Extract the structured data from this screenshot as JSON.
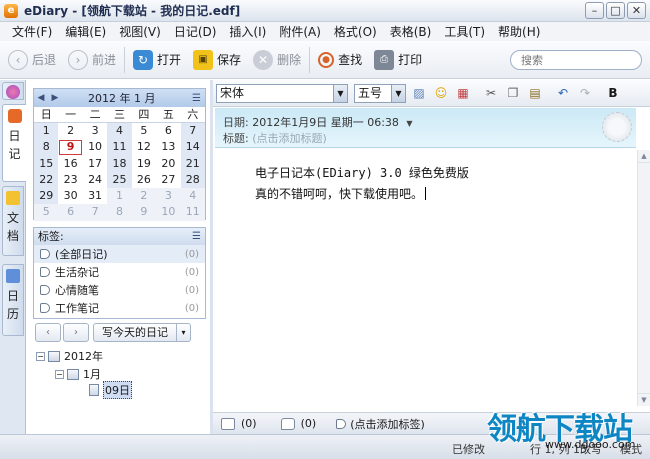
{
  "window": {
    "title": "eDiary - [领航下载站 - 我的日记.edf]",
    "controls": [
      "–",
      "□",
      "✕"
    ]
  },
  "menu": [
    "文件(F)",
    "编辑(E)",
    "视图(V)",
    "日记(D)",
    "插入(I)",
    "附件(A)",
    "格式(O)",
    "表格(B)",
    "工具(T)",
    "帮助(H)"
  ],
  "toolbar": {
    "back": "后退",
    "forward": "前进",
    "open": "打开",
    "save": "保存",
    "delete": "删除",
    "find": "查找",
    "print": "打印",
    "search_placeholder": "搜索"
  },
  "left_tabs": {
    "diary": [
      "日",
      "记"
    ],
    "docs": [
      "文",
      "档"
    ],
    "calendar": [
      "日",
      "历"
    ]
  },
  "calendar": {
    "title": "2012 年 1 月",
    "weekdays": [
      "日",
      "一",
      "二",
      "三",
      "四",
      "五",
      "六"
    ],
    "weeks": [
      [
        1,
        2,
        3,
        4,
        5,
        6,
        7
      ],
      [
        8,
        9,
        10,
        11,
        12,
        13,
        14
      ],
      [
        15,
        16,
        17,
        18,
        19,
        20,
        21
      ],
      [
        22,
        23,
        24,
        25,
        26,
        27,
        28
      ],
      [
        29,
        30,
        31,
        1,
        2,
        3,
        4
      ],
      [
        5,
        6,
        7,
        8,
        9,
        10,
        11
      ]
    ],
    "today": 9
  },
  "tags": {
    "header": "标签:",
    "items": [
      {
        "label": "(全部日记)",
        "count": "(0)"
      },
      {
        "label": "生活杂记",
        "count": "(0)"
      },
      {
        "label": "心情随笔",
        "count": "(0)"
      },
      {
        "label": "工作笔记",
        "count": "(0)"
      }
    ]
  },
  "nav": {
    "prev": "‹",
    "next": "›",
    "write_today": "写今天的日记",
    "dropdown": "▾"
  },
  "tree": {
    "year": "2012年",
    "month": "1月",
    "day": "09日"
  },
  "format": {
    "font": "宋体",
    "size": "五号",
    "bold": "B"
  },
  "meta": {
    "date_label": "日期:",
    "date_value": "2012年1月9日  星期一  06:38",
    "title_label": "标题:",
    "title_placeholder": "(点击添加标题)"
  },
  "editor": {
    "lines": [
      "电子日记本(EDiary) 3.0 绿色免费版",
      "真的不错呵呵，快下载使用吧。"
    ]
  },
  "bottom": {
    "attach_count": "(0)",
    "comment_count": "(0)",
    "tag_placeholder": "(点击添加标签)"
  },
  "status": {
    "modified": "已修改",
    "pos": "行 1, 列 15",
    "mode": "改写",
    "view": "模式"
  },
  "watermark": {
    "text": "领航下载站",
    "url": "www.ddooo.com"
  }
}
